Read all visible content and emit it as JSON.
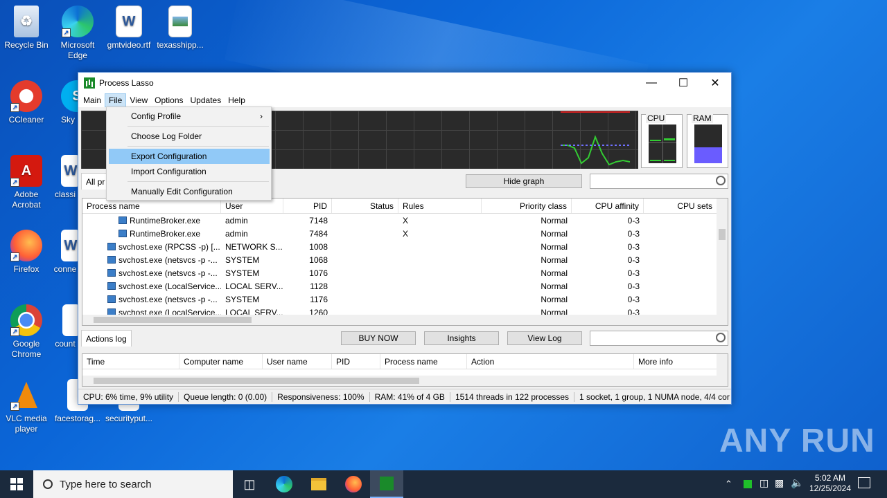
{
  "desktop": {
    "icons": [
      {
        "label": "Recycle Bin"
      },
      {
        "label": "Microsoft Edge"
      },
      {
        "label": "gmtvideo.rtf"
      },
      {
        "label": "texasshipp..."
      },
      {
        "label": "CCleaner"
      },
      {
        "label": "Sky"
      },
      {
        "label": "Adobe Acrobat"
      },
      {
        "label": "classi"
      },
      {
        "label": "Firefox"
      },
      {
        "label": "conne"
      },
      {
        "label": "Google Chrome"
      },
      {
        "label": "count"
      },
      {
        "label": "VLC media player"
      },
      {
        "label": "facestorag..."
      },
      {
        "label": "securityput..."
      }
    ]
  },
  "window": {
    "title": "Process Lasso",
    "menu": [
      "Main",
      "File",
      "View",
      "Options",
      "Updates",
      "Help"
    ],
    "gauges": {
      "cpu_label": "CPU",
      "ram_label": "RAM",
      "ram_fraction": 0.41
    },
    "tab_all": "All pr",
    "hide_graph": "Hide graph",
    "columns": [
      "Process name",
      "User",
      "PID",
      "Status",
      "Rules",
      "Priority class",
      "CPU affinity",
      "CPU sets"
    ],
    "rows": [
      {
        "name": "RuntimeBroker.exe",
        "user": "admin",
        "pid": "7148",
        "status": "",
        "rules": "X",
        "priority": "Normal",
        "affinity": "0-3",
        "indent": true
      },
      {
        "name": "RuntimeBroker.exe",
        "user": "admin",
        "pid": "7484",
        "status": "",
        "rules": "X",
        "priority": "Normal",
        "affinity": "0-3",
        "indent": true
      },
      {
        "name": "svchost.exe (RPCSS -p) [...",
        "user": "NETWORK S...",
        "pid": "1008",
        "status": "",
        "rules": "",
        "priority": "Normal",
        "affinity": "0-3",
        "indent": false
      },
      {
        "name": "svchost.exe (netsvcs -p -...",
        "user": "SYSTEM",
        "pid": "1068",
        "status": "",
        "rules": "",
        "priority": "Normal",
        "affinity": "0-3",
        "indent": false
      },
      {
        "name": "svchost.exe (netsvcs -p -...",
        "user": "SYSTEM",
        "pid": "1076",
        "status": "",
        "rules": "",
        "priority": "Normal",
        "affinity": "0-3",
        "indent": false
      },
      {
        "name": "svchost.exe (LocalService...",
        "user": "LOCAL SERV...",
        "pid": "1128",
        "status": "",
        "rules": "",
        "priority": "Normal",
        "affinity": "0-3",
        "indent": false
      },
      {
        "name": "svchost.exe (netsvcs -p -...",
        "user": "SYSTEM",
        "pid": "1176",
        "status": "",
        "rules": "",
        "priority": "Normal",
        "affinity": "0-3",
        "indent": false
      },
      {
        "name": "svchost.exe (LocalService...",
        "user": "LOCAL SERV...",
        "pid": "1260",
        "status": "",
        "rules": "",
        "priority": "Normal",
        "affinity": "0-3",
        "indent": false
      }
    ],
    "actions_log_tab": "Actions log",
    "buy_now": "BUY NOW",
    "insights": "Insights",
    "view_log": "View Log",
    "log_columns": [
      "Time",
      "Computer name",
      "User name",
      "PID",
      "Process name",
      "Action",
      "More info"
    ],
    "status": {
      "cpu": "CPU: 6% time, 9% utility",
      "queue": "Queue length: 0 (0.00)",
      "responsiveness": "Responsiveness: 100%",
      "ram": "RAM: 41% of 4 GB",
      "threads": "1514 threads in 122 processes",
      "topology": "1 socket, 1 group, 1 NUMA node, 4/4 cor"
    }
  },
  "file_menu": {
    "config_profile": "Config Profile",
    "choose_log_folder": "Choose Log Folder",
    "export_configuration": "Export Configuration",
    "import_configuration": "Import Configuration",
    "manually_edit": "Manually Edit Configuration"
  },
  "taskbar": {
    "search_placeholder": "Type here to search",
    "time": "5:02 AM",
    "date": "12/25/2024"
  },
  "watermark": "ANY RUN",
  "colors": {
    "highlight": "#91c9f7",
    "taskbar": "#1b2a3d",
    "graph_line": "#33cc33"
  }
}
